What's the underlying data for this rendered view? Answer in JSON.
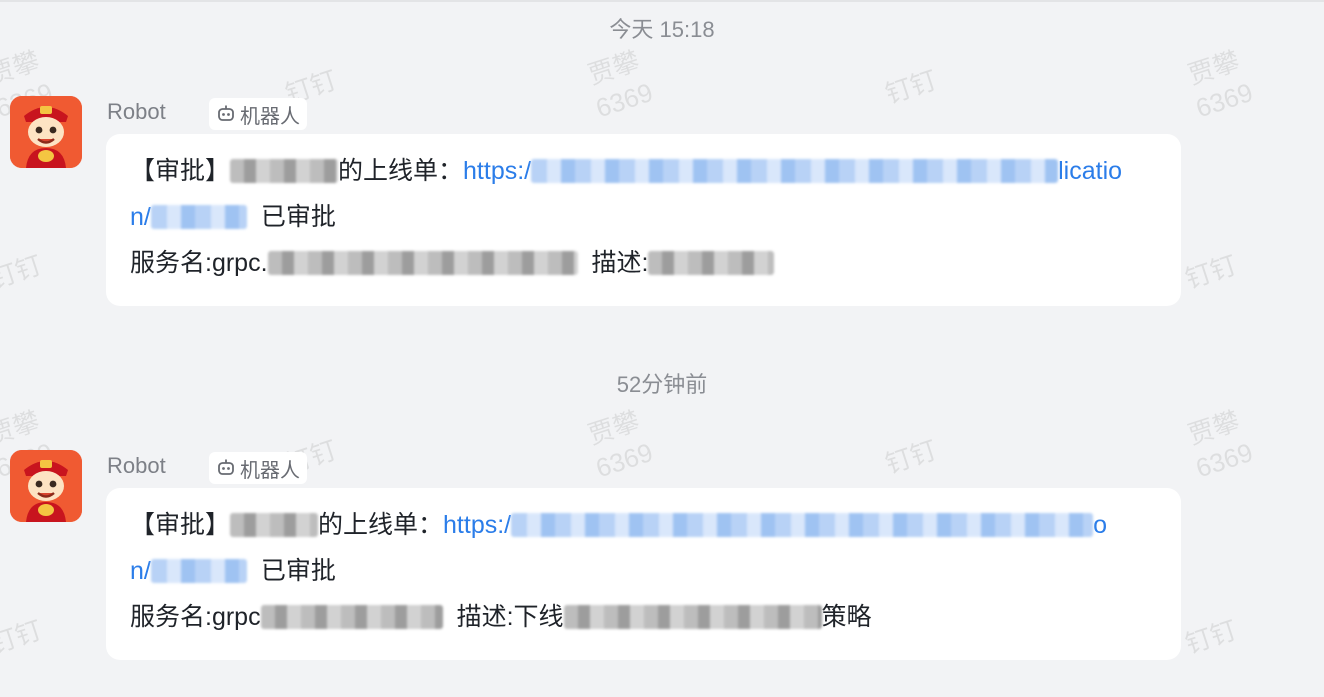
{
  "watermark": {
    "name": "贾攀",
    "id": "6369",
    "app": "钉钉"
  },
  "messages": [
    {
      "time": "今天 15:18",
      "sender": "Robot",
      "bot_tag": "机器人",
      "title_prefix": "【审批】",
      "title_suffix": "的上线单：",
      "link_start": "https:/",
      "link_end": "licatio",
      "link_line2_start": "n/",
      "approved": "已审批",
      "service_label": "服务名:grpc.",
      "desc_label": "描述:",
      "desc_tail": ""
    },
    {
      "time": "52分钟前",
      "sender": "Robot",
      "bot_tag": "机器人",
      "title_prefix": "【审批】",
      "title_suffix": "的上线单：",
      "link_start": "https:/",
      "link_end": "o",
      "link_line2_start": "n/",
      "approved": "已审批",
      "service_label": "服务名:grpc",
      "desc_label": "描述:下线",
      "desc_tail": "策略"
    }
  ],
  "colors": {
    "background": "#f2f3f5",
    "bubble": "#ffffff",
    "link": "#2b7de9",
    "avatar": "#f05a32"
  },
  "icons": {
    "avatar": "cartoon-god-of-wealth-avatar",
    "bot": "robot-icon"
  }
}
